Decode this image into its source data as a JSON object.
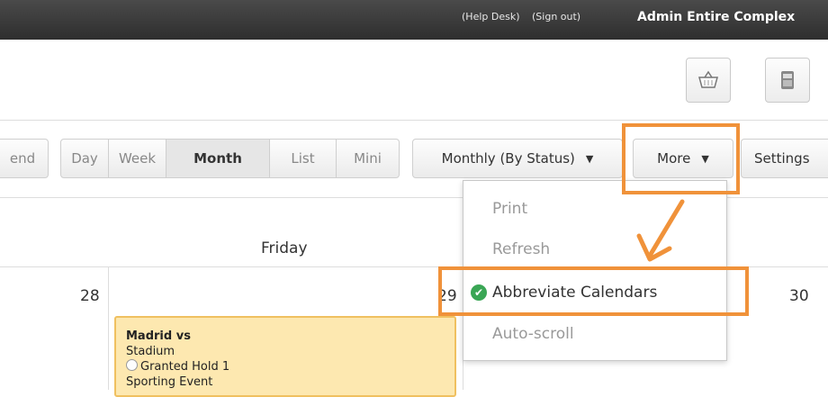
{
  "topbar": {
    "help_desk": "(Help Desk)",
    "sign_out": "(Sign out)",
    "account": "Admin Entire Complex"
  },
  "toolbar": {
    "prev_partial": "end",
    "views": [
      "Day",
      "Week",
      "Month",
      "List",
      "Mini"
    ],
    "active_view": "Month",
    "mode_label": "Monthly (By Status)",
    "more_label": "More",
    "settings_label": "Settings",
    "caret": "▼"
  },
  "calendar": {
    "weekday_header": "Friday",
    "day_numbers": [
      "28",
      "29",
      "30"
    ],
    "event": {
      "title": "Madrid vs",
      "location": "Stadium",
      "status": "Granted Hold 1",
      "type": "Sporting Event"
    }
  },
  "more_menu": {
    "items": [
      "Print",
      "Refresh",
      "Abbreviate Calendars",
      "Auto-scroll"
    ],
    "checked_item": "Abbreviate Calendars"
  },
  "colors": {
    "highlight": "#f0923a",
    "event_bg": "#fde8b0",
    "check": "#3aa655"
  }
}
